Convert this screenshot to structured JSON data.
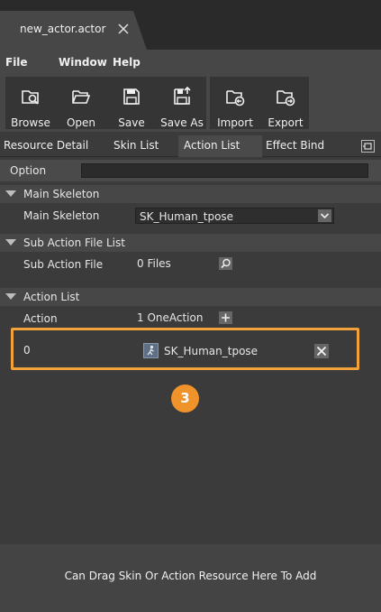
{
  "document_tab": {
    "title": "new_actor.actor",
    "close_icon": "close-icon"
  },
  "menu": {
    "file": "File",
    "window": "Window",
    "help": "Help"
  },
  "toolbar": {
    "browse": "Browse",
    "open": "Open",
    "save": "Save",
    "save_as": "Save As",
    "import": "Import",
    "export": "Export"
  },
  "tabs": {
    "resource_detail": "Resource Detail",
    "skin_list": "Skin List",
    "action_list": "Action List",
    "effect_bind": "Effect Bind",
    "active": "Action List"
  },
  "option": {
    "label": "Option",
    "value": ""
  },
  "main_skeleton": {
    "section_title": "Main Skeleton",
    "label": "Main Skeleton",
    "value": "SK_Human_tpose"
  },
  "sub_action": {
    "section_title": "Sub Action File List",
    "label": "Sub Action File",
    "value": "0 Files"
  },
  "action_list": {
    "section_title": "Action List",
    "label": "Action",
    "value": "1 OneAction",
    "rows": [
      {
        "index": "0",
        "skeleton": "SK_Human_tpose"
      }
    ]
  },
  "callout": "3",
  "drop_zone": {
    "text": "Can Drag Skin Or Action Resource Here To Add"
  },
  "colors": {
    "highlight": "#f2a23a",
    "callout": "#f0932b",
    "panel": "#3b3b3b"
  }
}
